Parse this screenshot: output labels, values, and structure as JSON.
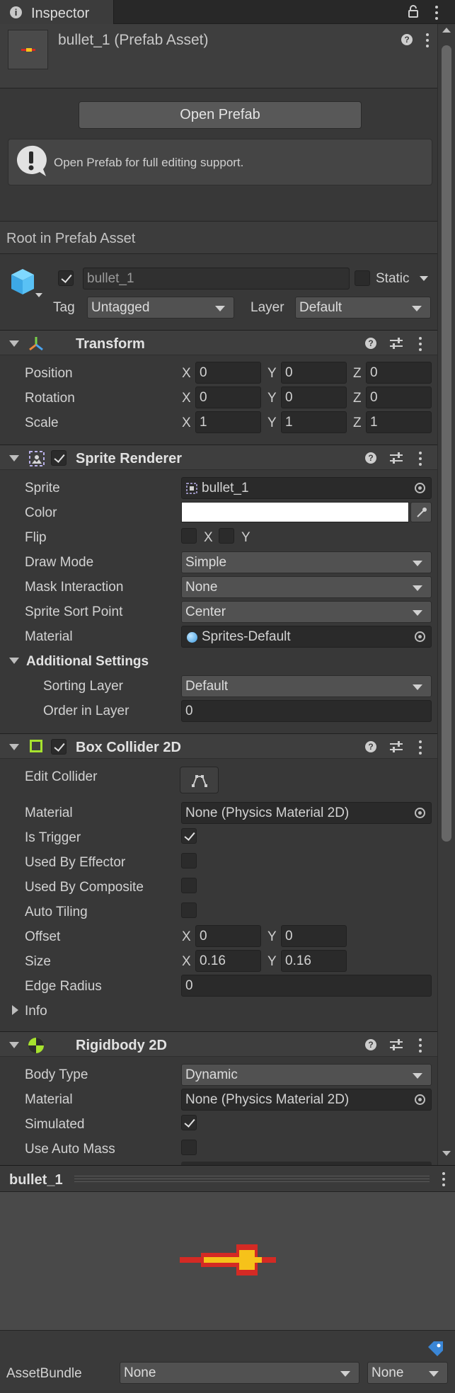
{
  "tab": {
    "title": "Inspector"
  },
  "header": {
    "title": "bullet_1 (Prefab Asset)",
    "open_button": "Open Prefab",
    "help_text": "Open Prefab for full editing support."
  },
  "root_label": "Root in Prefab Asset",
  "object": {
    "name": "bullet_1",
    "static_label": "Static",
    "tag_label": "Tag",
    "tag_value": "Untagged",
    "layer_label": "Layer",
    "layer_value": "Default"
  },
  "transform": {
    "title": "Transform",
    "rows": [
      {
        "label": "Position",
        "x": "0",
        "y": "0",
        "z": "0"
      },
      {
        "label": "Rotation",
        "x": "0",
        "y": "0",
        "z": "0"
      },
      {
        "label": "Scale",
        "x": "1",
        "y": "1",
        "z": "1"
      }
    ],
    "axis": {
      "x": "X",
      "y": "Y",
      "z": "Z"
    }
  },
  "sprite_renderer": {
    "title": "Sprite Renderer",
    "sprite_label": "Sprite",
    "sprite_value": "bullet_1",
    "color_label": "Color",
    "color_value": "#ffffff",
    "flip_label": "Flip",
    "flip_x": "X",
    "flip_y": "Y",
    "draw_mode_label": "Draw Mode",
    "draw_mode_value": "Simple",
    "mask_label": "Mask Interaction",
    "mask_value": "None",
    "sort_point_label": "Sprite Sort Point",
    "sort_point_value": "Center",
    "material_label": "Material",
    "material_value": "Sprites-Default",
    "additional_title": "Additional Settings",
    "sorting_layer_label": "Sorting Layer",
    "sorting_layer_value": "Default",
    "order_label": "Order in Layer",
    "order_value": "0"
  },
  "box_collider": {
    "title": "Box Collider 2D",
    "edit_label": "Edit Collider",
    "material_label": "Material",
    "material_value": "None (Physics Material 2D)",
    "is_trigger_label": "Is Trigger",
    "is_trigger": true,
    "effector_label": "Used By Effector",
    "effector": false,
    "composite_label": "Used By Composite",
    "composite": false,
    "auto_tiling_label": "Auto Tiling",
    "auto_tiling": false,
    "offset_label": "Offset",
    "offset_x": "0",
    "offset_y": "0",
    "size_label": "Size",
    "size_x": "0.16",
    "size_y": "0.16",
    "edge_label": "Edge Radius",
    "edge_value": "0",
    "info_label": "Info"
  },
  "rigidbody": {
    "title": "Rigidbody 2D",
    "body_type_label": "Body Type",
    "body_type_value": "Dynamic",
    "material_label": "Material",
    "material_value": "None (Physics Material 2D)",
    "simulated_label": "Simulated",
    "simulated": true,
    "auto_mass_label": "Use Auto Mass",
    "auto_mass": false
  },
  "preview": {
    "title": "bullet_1"
  },
  "asset_bundle": {
    "label": "AssetBundle",
    "name_value": "None",
    "variant_value": "None"
  },
  "colors": {
    "background": "#383838",
    "header": "#3e3e3e",
    "field": "#2a2a2a",
    "bullet_red": "#d42a24",
    "bullet_yellow": "#f6c21a"
  }
}
